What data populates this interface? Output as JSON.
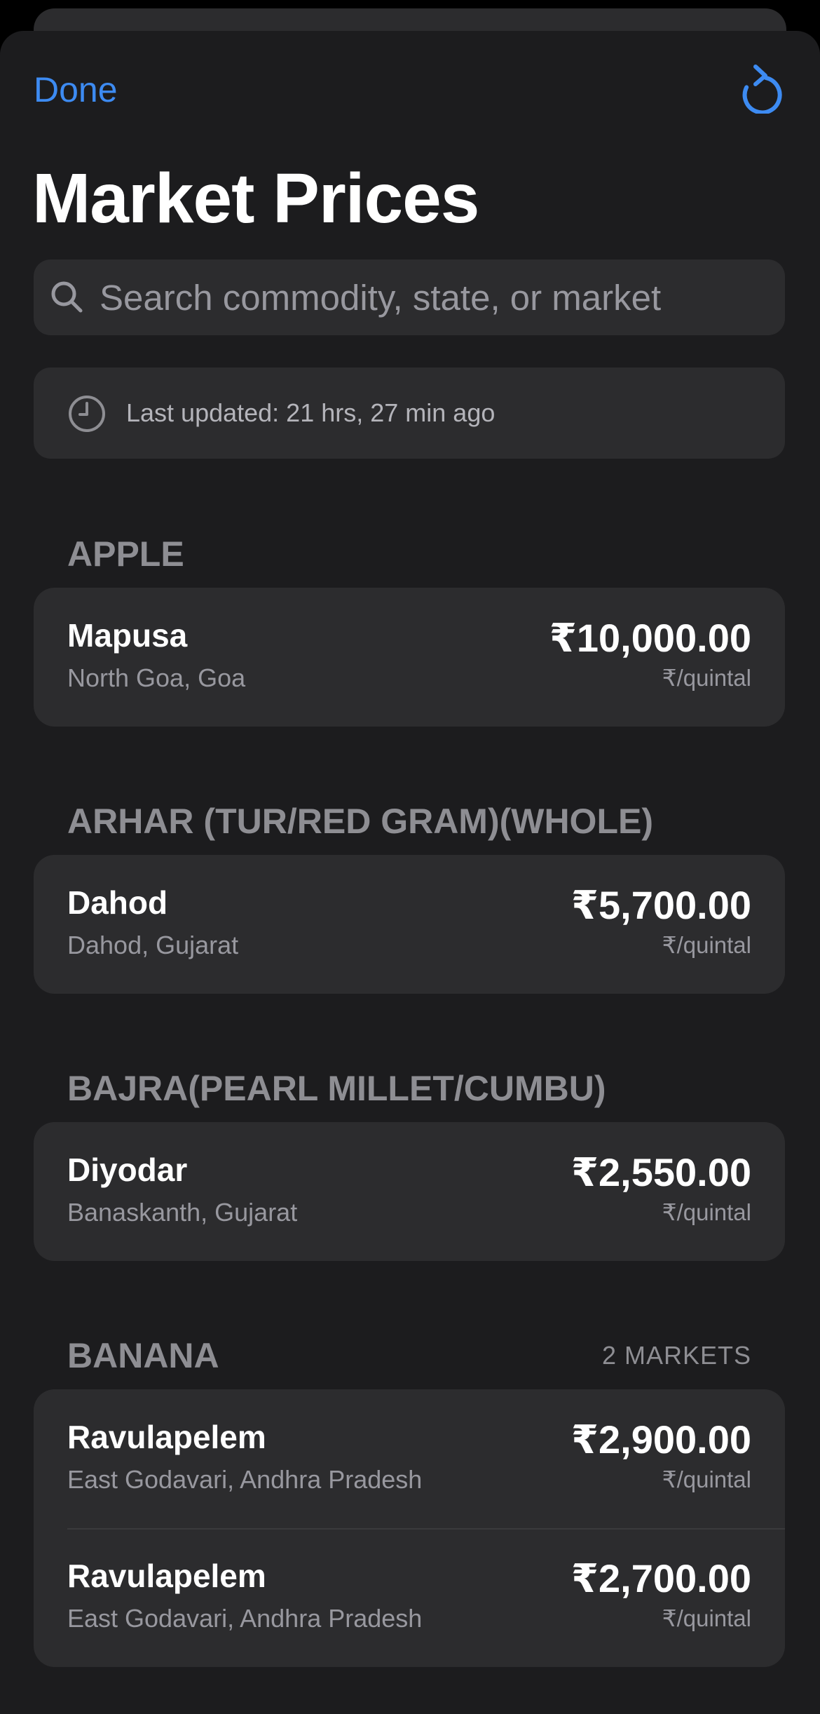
{
  "header": {
    "done_label": "Done",
    "refresh_icon": "refresh-icon",
    "title": "Market Prices"
  },
  "search": {
    "placeholder": "Search commodity, state, or market",
    "value": ""
  },
  "status": {
    "clock_icon": "clock-icon",
    "last_updated": "Last updated: 21 hrs, 27 min ago"
  },
  "colors": {
    "accent": "#3d8bf2",
    "background": "#000000",
    "sheet": "#1c1c1e",
    "card": "#2c2c2e",
    "secondary_text": "#98989f"
  },
  "sections": [
    {
      "commodity": "APPLE",
      "count": "",
      "markets": [
        {
          "name": "Mapusa",
          "location": "North Goa, Goa",
          "price": "₹10,000.00",
          "unit": "₹/quintal"
        }
      ]
    },
    {
      "commodity": "ARHAR (TUR/RED GRAM)(WHOLE)",
      "count": "",
      "markets": [
        {
          "name": "Dahod",
          "location": "Dahod, Gujarat",
          "price": "₹5,700.00",
          "unit": "₹/quintal"
        }
      ]
    },
    {
      "commodity": "BAJRA(PEARL MILLET/CUMBU)",
      "count": "",
      "markets": [
        {
          "name": "Diyodar",
          "location": "Banaskanth, Gujarat",
          "price": "₹2,550.00",
          "unit": "₹/quintal"
        }
      ]
    },
    {
      "commodity": "BANANA",
      "count": "2 MARKETS",
      "markets": [
        {
          "name": "Ravulapelem",
          "location": "East Godavari, Andhra Pradesh",
          "price": "₹2,900.00",
          "unit": "₹/quintal"
        },
        {
          "name": "Ravulapelem",
          "location": "East Godavari, Andhra Pradesh",
          "price": "₹2,700.00",
          "unit": "₹/quintal"
        }
      ]
    }
  ]
}
